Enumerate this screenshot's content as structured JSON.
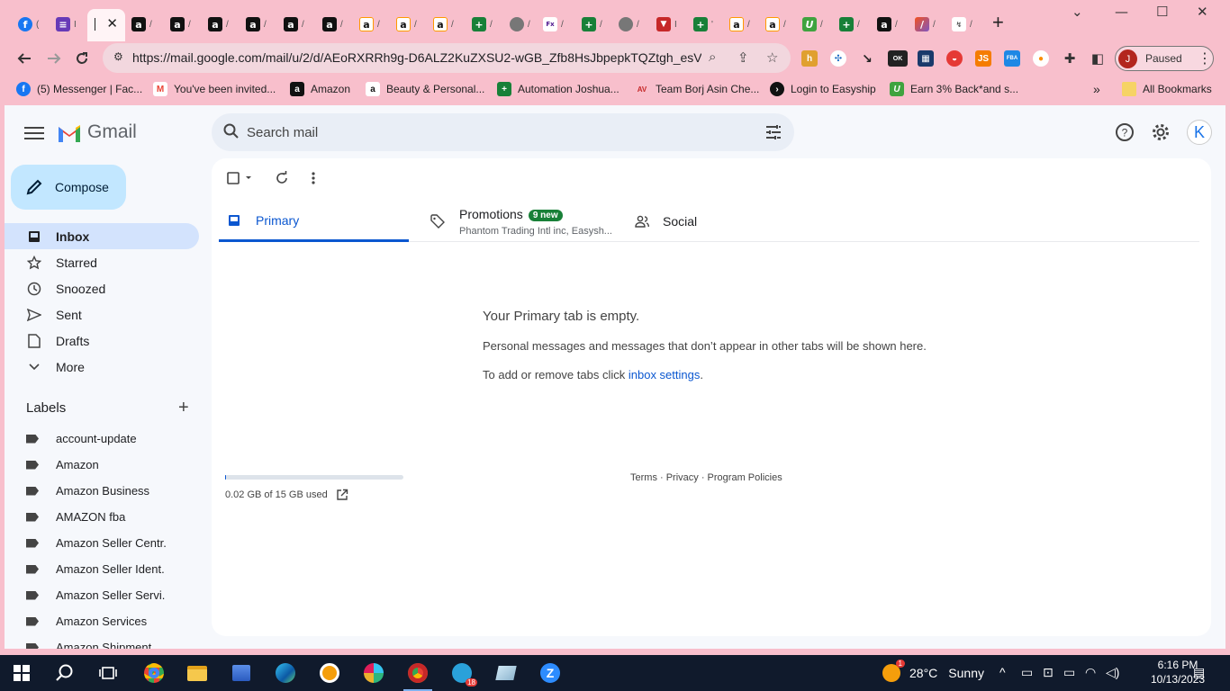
{
  "browser": {
    "tabs_icons": [
      "facebook-icon",
      "forms-icon",
      "active-tab",
      "amazon-icon",
      "amazon-icon",
      "amazon-icon",
      "amazon-icon",
      "amazon-icon",
      "amazon-icon",
      "amazon-smile-icon",
      "amazon-smile-icon",
      "amazon-smile-icon",
      "sheets-icon",
      "globe-icon",
      "fedex-icon",
      "sheets-icon",
      "globe-icon",
      "vpn-icon",
      "sheets-icon",
      "amazon-smile-icon",
      "amazon-smile-icon",
      "topcashback-icon",
      "sheets-icon",
      "amazon-icon",
      "pencil-icon",
      "chart-icon"
    ],
    "url": "https://mail.google.com/mail/u/2/d/AEoRXRRh9g-D6ALZ2KuZXSU2-wGB_Zfb8HsJbpepkTQZtgh_esV...",
    "profile_initial": "J",
    "profile_status": "Paused",
    "extension_badge": "OK"
  },
  "bookmarks": [
    {
      "label": "(5) Messenger | Fac...",
      "icon": "facebook-icon"
    },
    {
      "label": "You've been invited...",
      "icon": "gmail-icon"
    },
    {
      "label": "Amazon",
      "icon": "amazon-icon"
    },
    {
      "label": "Beauty & Personal...",
      "icon": "amazon-smile-icon"
    },
    {
      "label": "Automation Joshua...",
      "icon": "sheets-icon"
    },
    {
      "label": "Team Borj Asin Che...",
      "icon": "team-icon"
    },
    {
      "label": "Login to Easyship",
      "icon": "easyship-icon"
    },
    {
      "label": "Earn 3% Back*and s...",
      "icon": "topcashback-icon"
    }
  ],
  "all_bookmarks": "All Bookmarks",
  "gmail": {
    "app_name": "Gmail",
    "search_placeholder": "Search mail",
    "account_initial": "K",
    "compose": "Compose",
    "nav": [
      {
        "label": "Inbox",
        "icon": "inbox-icon"
      },
      {
        "label": "Starred",
        "icon": "star-icon"
      },
      {
        "label": "Snoozed",
        "icon": "clock-icon"
      },
      {
        "label": "Sent",
        "icon": "send-icon"
      },
      {
        "label": "Drafts",
        "icon": "draft-icon"
      },
      {
        "label": "More",
        "icon": "chevron-down-icon"
      }
    ],
    "labels_heading": "Labels",
    "labels": [
      "account-update",
      "Amazon",
      "Amazon Business",
      "AMAZON fba",
      "Amazon Seller Centr.",
      "Amazon Seller Ident.",
      "Amazon Seller Servi.",
      "Amazon Services",
      "Amazon Shipment"
    ],
    "tabs": {
      "primary": "Primary",
      "promotions": "Promotions",
      "promotions_badge": "9 new",
      "promotions_snippet": "Phantom Trading Intl inc, Easysh...",
      "social": "Social"
    },
    "empty": {
      "title": "Your Primary tab is empty.",
      "line1": "Personal messages and messages that don’t appear in other tabs will be shown here.",
      "line2_prefix": "To add or remove tabs click ",
      "line2_link": "inbox settings",
      "line2_suffix": "."
    },
    "storage": {
      "text": "0.02 GB of 15 GB used",
      "used_fraction": 0.0013
    },
    "footer": "Terms · Privacy · Program Policies"
  },
  "taskbar": {
    "weather_temp": "28°C",
    "weather_desc": "Sunny",
    "weather_badge": "1",
    "telegram_badge": "18",
    "time": "6:16 PM",
    "date": "10/13/2023"
  }
}
